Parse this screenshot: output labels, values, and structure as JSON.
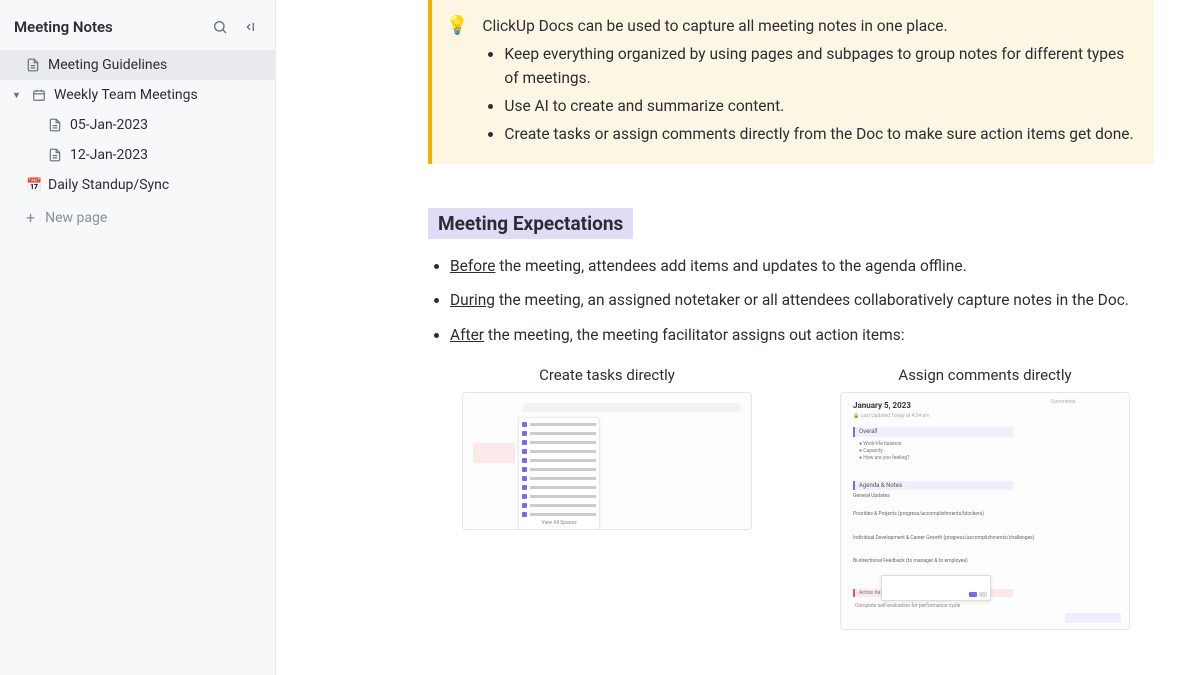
{
  "sidebar": {
    "title": "Meeting Notes",
    "items": [
      {
        "label": "Meeting Guidelines",
        "icon": "doc"
      },
      {
        "label": "Weekly Team Meetings",
        "icon": "calendar-inline",
        "expanded": true
      },
      {
        "label": "05-Jan-2023",
        "icon": "doc"
      },
      {
        "label": "12-Jan-2023",
        "icon": "doc"
      },
      {
        "label": "Daily Standup/Sync",
        "icon": "calendar-emoji"
      }
    ],
    "newPage": "New page"
  },
  "callout": {
    "icon": "💡",
    "intro": "ClickUp Docs can be used to capture all meeting notes in one place.",
    "bullets": [
      "Keep everything organized by using pages and subpages to group notes for different types of meetings.",
      "Use AI to create and summarize content.",
      "Create tasks or assign comments directly from the Doc to make sure action items get done."
    ]
  },
  "section": {
    "title": "Meeting Expectations",
    "items": [
      {
        "u": "Before",
        "rest": " the meeting, attendees add items and updates to the agenda offline."
      },
      {
        "u": "During",
        "rest": " the meeting, an assigned notetaker or all attendees collaboratively capture notes in the Doc."
      },
      {
        "u": "After",
        "rest": " the meeting, the meeting facilitator assigns out action items:"
      }
    ]
  },
  "columns": {
    "left": "Create tasks directly",
    "right": "Assign comments directly"
  },
  "thumb1": {
    "menuItems": [
      "Agile Project Management",
      "Agile Scrum Management",
      "Release Train",
      "Software Development",
      "Software Teams Template",
      "Marketing Teams",
      "Marketing Template",
      "Marketing Team Operations",
      "Agency Management",
      "Creative Agency Template",
      "Freelance Teams"
    ],
    "footer": "View All Spaces"
  },
  "thumb2": {
    "date": "January 5, 2023",
    "overall": "Overall",
    "dots": "● Work-life balance\n● Capacity\n● How are you feeling?",
    "agenda": "Agenda & Notes",
    "gu": "General Updates",
    "pp": "Priorities & Projects (progress/accomplishments/blockers)",
    "idc": "Individual Development & Career Growth (progress/accomplishments/challenges)",
    "bf": "Bi-directional Feedback (to manager & to employee)",
    "action": "Action Ite",
    "foot": "Complete self-evaluation for performance cycle",
    "comments": "Comments"
  }
}
